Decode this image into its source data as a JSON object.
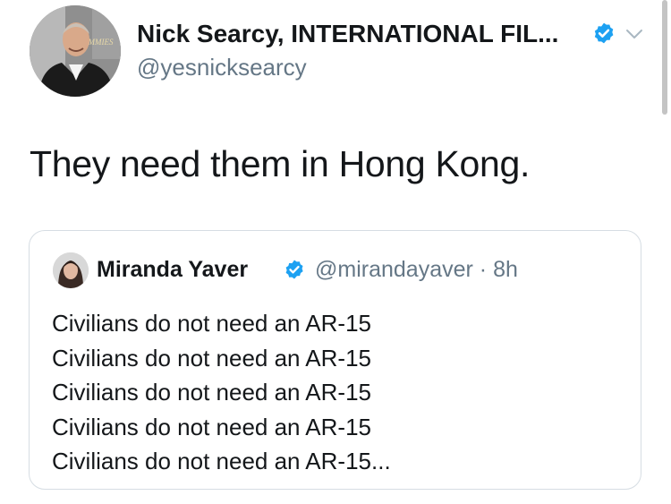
{
  "tweet": {
    "author_name": "Nick Searcy, INTERNATIONAL FIL...",
    "author_handle": "@yesnicksearcy",
    "text": "They need them in Hong Kong.",
    "verified_icon": "verified-badge-icon",
    "menu_icon": "chevron-down-icon",
    "avatar_background_text": "EMMIES"
  },
  "quoted_tweet": {
    "author_name": "Miranda Yaver",
    "author_handle": "@mirandayaver",
    "separator": "·",
    "time": "8h",
    "lines": [
      "Civilians do not need an AR-15",
      "Civilians do not need an AR-15",
      "Civilians do not need an AR-15",
      "Civilians do not need an AR-15",
      "Civilians do not need an AR-15..."
    ]
  },
  "colors": {
    "verified": "#1da1f2",
    "secondary_text": "#657786",
    "primary_text": "#14171a",
    "card_border": "#d6dde3"
  }
}
